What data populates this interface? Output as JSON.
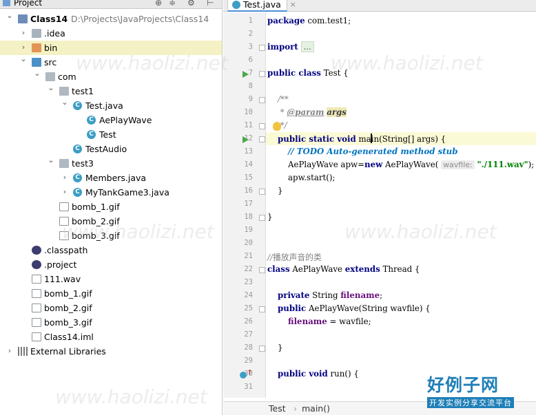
{
  "project_panel": {
    "title": "Project",
    "tree": [
      {
        "label": "Class14",
        "sub": "D:\\Projects\\JavaProjects\\Class14",
        "icon": "module",
        "depth": 0,
        "arrow": "down",
        "bold": true
      },
      {
        "label": ".idea",
        "icon": "folder",
        "depth": 1,
        "arrow": "right"
      },
      {
        "label": "bin",
        "icon": "folder-orange",
        "depth": 1,
        "arrow": "right",
        "selected": true
      },
      {
        "label": "src",
        "icon": "folder-blue",
        "depth": 1,
        "arrow": "down"
      },
      {
        "label": "com",
        "icon": "package",
        "depth": 2,
        "arrow": "down"
      },
      {
        "label": "test1",
        "icon": "package",
        "depth": 3,
        "arrow": "down"
      },
      {
        "label": "Test.java",
        "icon": "class",
        "depth": 4,
        "arrow": "down"
      },
      {
        "label": "AePlayWave",
        "icon": "class",
        "depth": 5,
        "arrow": ""
      },
      {
        "label": "Test",
        "icon": "class",
        "depth": 5,
        "arrow": ""
      },
      {
        "label": "TestAudio",
        "icon": "class",
        "depth": 4,
        "arrow": ""
      },
      {
        "label": "test3",
        "icon": "package",
        "depth": 3,
        "arrow": "down"
      },
      {
        "label": "Members.java",
        "icon": "class",
        "depth": 4,
        "arrow": "right"
      },
      {
        "label": "MyTankGame3.java",
        "icon": "class",
        "depth": 4,
        "arrow": "right"
      },
      {
        "label": "bomb_1.gif",
        "icon": "file",
        "depth": 3,
        "arrow": ""
      },
      {
        "label": "bomb_2.gif",
        "icon": "file",
        "depth": 3,
        "arrow": ""
      },
      {
        "label": "bomb_3.gif",
        "icon": "file",
        "depth": 3,
        "arrow": ""
      },
      {
        "label": ".classpath",
        "icon": "eclipse",
        "depth": 1,
        "arrow": ""
      },
      {
        "label": ".project",
        "icon": "eclipse",
        "depth": 1,
        "arrow": ""
      },
      {
        "label": "111.wav",
        "icon": "file",
        "depth": 1,
        "arrow": ""
      },
      {
        "label": "bomb_1.gif",
        "icon": "file",
        "depth": 1,
        "arrow": ""
      },
      {
        "label": "bomb_2.gif",
        "icon": "file",
        "depth": 1,
        "arrow": ""
      },
      {
        "label": "bomb_3.gif",
        "icon": "file",
        "depth": 1,
        "arrow": ""
      },
      {
        "label": "Class14.iml",
        "icon": "file",
        "depth": 1,
        "arrow": ""
      },
      {
        "label": "External Libraries",
        "icon": "lib",
        "depth": 0,
        "arrow": "right"
      }
    ]
  },
  "editor": {
    "tab_label": "Test.java",
    "current_line": 12,
    "lines": [
      {
        "n": "1",
        "html": "<span class='kw'>package</span> com.test1;"
      },
      {
        "n": "2",
        "html": ""
      },
      {
        "n": "3",
        "html": "<span class='kw'>import</span> <span class='collapsed'>...</span>"
      },
      {
        "n": "6",
        "html": ""
      },
      {
        "n": "7",
        "html": "<span class='kw'>public class</span> Test {"
      },
      {
        "n": "8",
        "html": ""
      },
      {
        "n": "9",
        "html": "    <span class='cm'>/**</span>"
      },
      {
        "n": "10",
        "html": "    <span class='cm'> * </span><span class='doctag'>@param</span> <span class='docparam'>args</span>"
      },
      {
        "n": "11",
        "html": "    <span class='cm'> */</span>"
      },
      {
        "n": "12",
        "html": "    <span class='kw'>public static void</span> ma<span class='caret'></span>in(String[] args) {"
      },
      {
        "n": "13",
        "html": "        <span class='todo'>// TODO Auto-generated method stub</span>"
      },
      {
        "n": "14",
        "html": "        AePlayWave apw=<span class='kw'>new</span> AePlayWave( <span class='hint'>wavfile:</span> <span class='str'>\"./111.wav\"</span>);"
      },
      {
        "n": "15",
        "html": "        apw.start();"
      },
      {
        "n": "16",
        "html": "    }"
      },
      {
        "n": "17",
        "html": ""
      },
      {
        "n": "18",
        "html": "}"
      },
      {
        "n": "19",
        "html": ""
      },
      {
        "n": "20",
        "html": ""
      },
      {
        "n": "21",
        "html": "<span class='cm'>//</span><span class='chcn'>播放声音的类</span>"
      },
      {
        "n": "22",
        "html": "<span class='kw'>class</span> AePlayWave <span class='kw'>extends</span> Thread {"
      },
      {
        "n": "23",
        "html": ""
      },
      {
        "n": "24",
        "html": "    <span class='kw'>private</span> String <span class='field'>filename</span>;"
      },
      {
        "n": "25",
        "html": "    <span class='kw'>public</span> AePlayWave(String wavfile) {"
      },
      {
        "n": "26",
        "html": "        <span class='field'>filename</span> = wavfile;"
      },
      {
        "n": "27",
        "html": ""
      },
      {
        "n": "28",
        "html": "    }"
      },
      {
        "n": "29",
        "html": ""
      },
      {
        "n": "30",
        "html": "    <span class='kw'>public void</span> run() {"
      },
      {
        "n": "31",
        "html": ""
      }
    ]
  },
  "breadcrumb": {
    "class_name": "Test",
    "separator": "›",
    "method": "main()"
  },
  "watermark": {
    "text": "www.haolizi.net",
    "logo_big": "好例子网",
    "logo_small": "开发实例分享交流平台"
  }
}
